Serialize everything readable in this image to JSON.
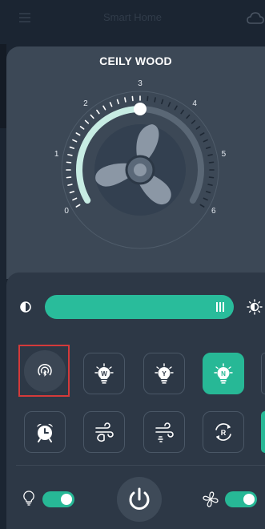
{
  "header": {
    "title": "Smart Home",
    "menu_icon": "menu-icon",
    "cloud_icon": "cloud-icon"
  },
  "device": {
    "name": "CEILY WOOD",
    "speed_labels": [
      "0",
      "1",
      "2",
      "3",
      "4",
      "5",
      "6"
    ],
    "current_speed": 3,
    "max_speed": 6
  },
  "brightness": {
    "level_percent": 100,
    "low_icon": "brightness-low-icon",
    "high_icon": "brightness-high-icon"
  },
  "light_modes": [
    {
      "id": "bluetooth",
      "icon": "bluetooth-broadcast-icon",
      "label": "",
      "state": "selected"
    },
    {
      "id": "warm",
      "icon": "bulb-w-icon",
      "label": "W",
      "state": "normal"
    },
    {
      "id": "yellow",
      "icon": "bulb-y-icon",
      "label": "Y",
      "state": "normal"
    },
    {
      "id": "natural",
      "icon": "bulb-n-icon",
      "label": "N",
      "state": "active"
    }
  ],
  "fan_modes": [
    {
      "id": "timer",
      "icon": "alarm-clock-icon",
      "label": "",
      "state": "normal"
    },
    {
      "id": "breeze",
      "icon": "breeze-wind-icon",
      "label": "",
      "state": "normal"
    },
    {
      "id": "wind",
      "icon": "wind-icon",
      "label": "",
      "state": "normal"
    },
    {
      "id": "reverse",
      "icon": "reverse-rotation-icon",
      "label": "R",
      "state": "normal"
    }
  ],
  "footer": {
    "light_toggle_on": true,
    "fan_toggle_on": true,
    "power_icon": "power-icon",
    "light_icon": "bulb-icon",
    "fan_icon": "fan-icon"
  },
  "colors": {
    "accent": "#27b896",
    "sheet": "#3c4856",
    "controls": "#2d3846",
    "highlight": "#d43a3a"
  }
}
